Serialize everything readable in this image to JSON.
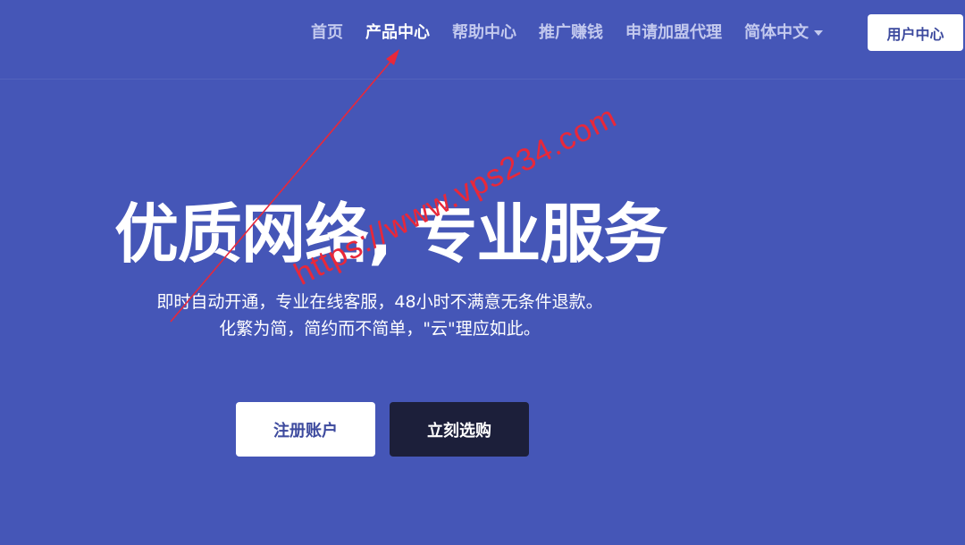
{
  "nav": {
    "items": [
      {
        "label": "首页"
      },
      {
        "label": "产品中心"
      },
      {
        "label": "帮助中心"
      },
      {
        "label": "推广赚钱"
      },
      {
        "label": "申请加盟代理"
      }
    ],
    "language": {
      "label": "简体中文",
      "icon": "caret-down-icon"
    },
    "user_center": "用户中心"
  },
  "hero": {
    "title": "优质网络, 专业服务",
    "subtitle_line1": "即时自动开通，专业在线客服，48小时不满意无条件退款。",
    "subtitle_line2": "化繁为简，简约而不简单，\"云\"理应如此。",
    "register_label": "注册账户",
    "buy_label": "立刻选购"
  },
  "overlay": {
    "watermark": "https://www.vps234.com"
  },
  "colors": {
    "background": "#4556b7",
    "nav_text": "#c3c9ee",
    "button_dark": "#1c1f3a",
    "annotation_red": "#e8283a"
  }
}
